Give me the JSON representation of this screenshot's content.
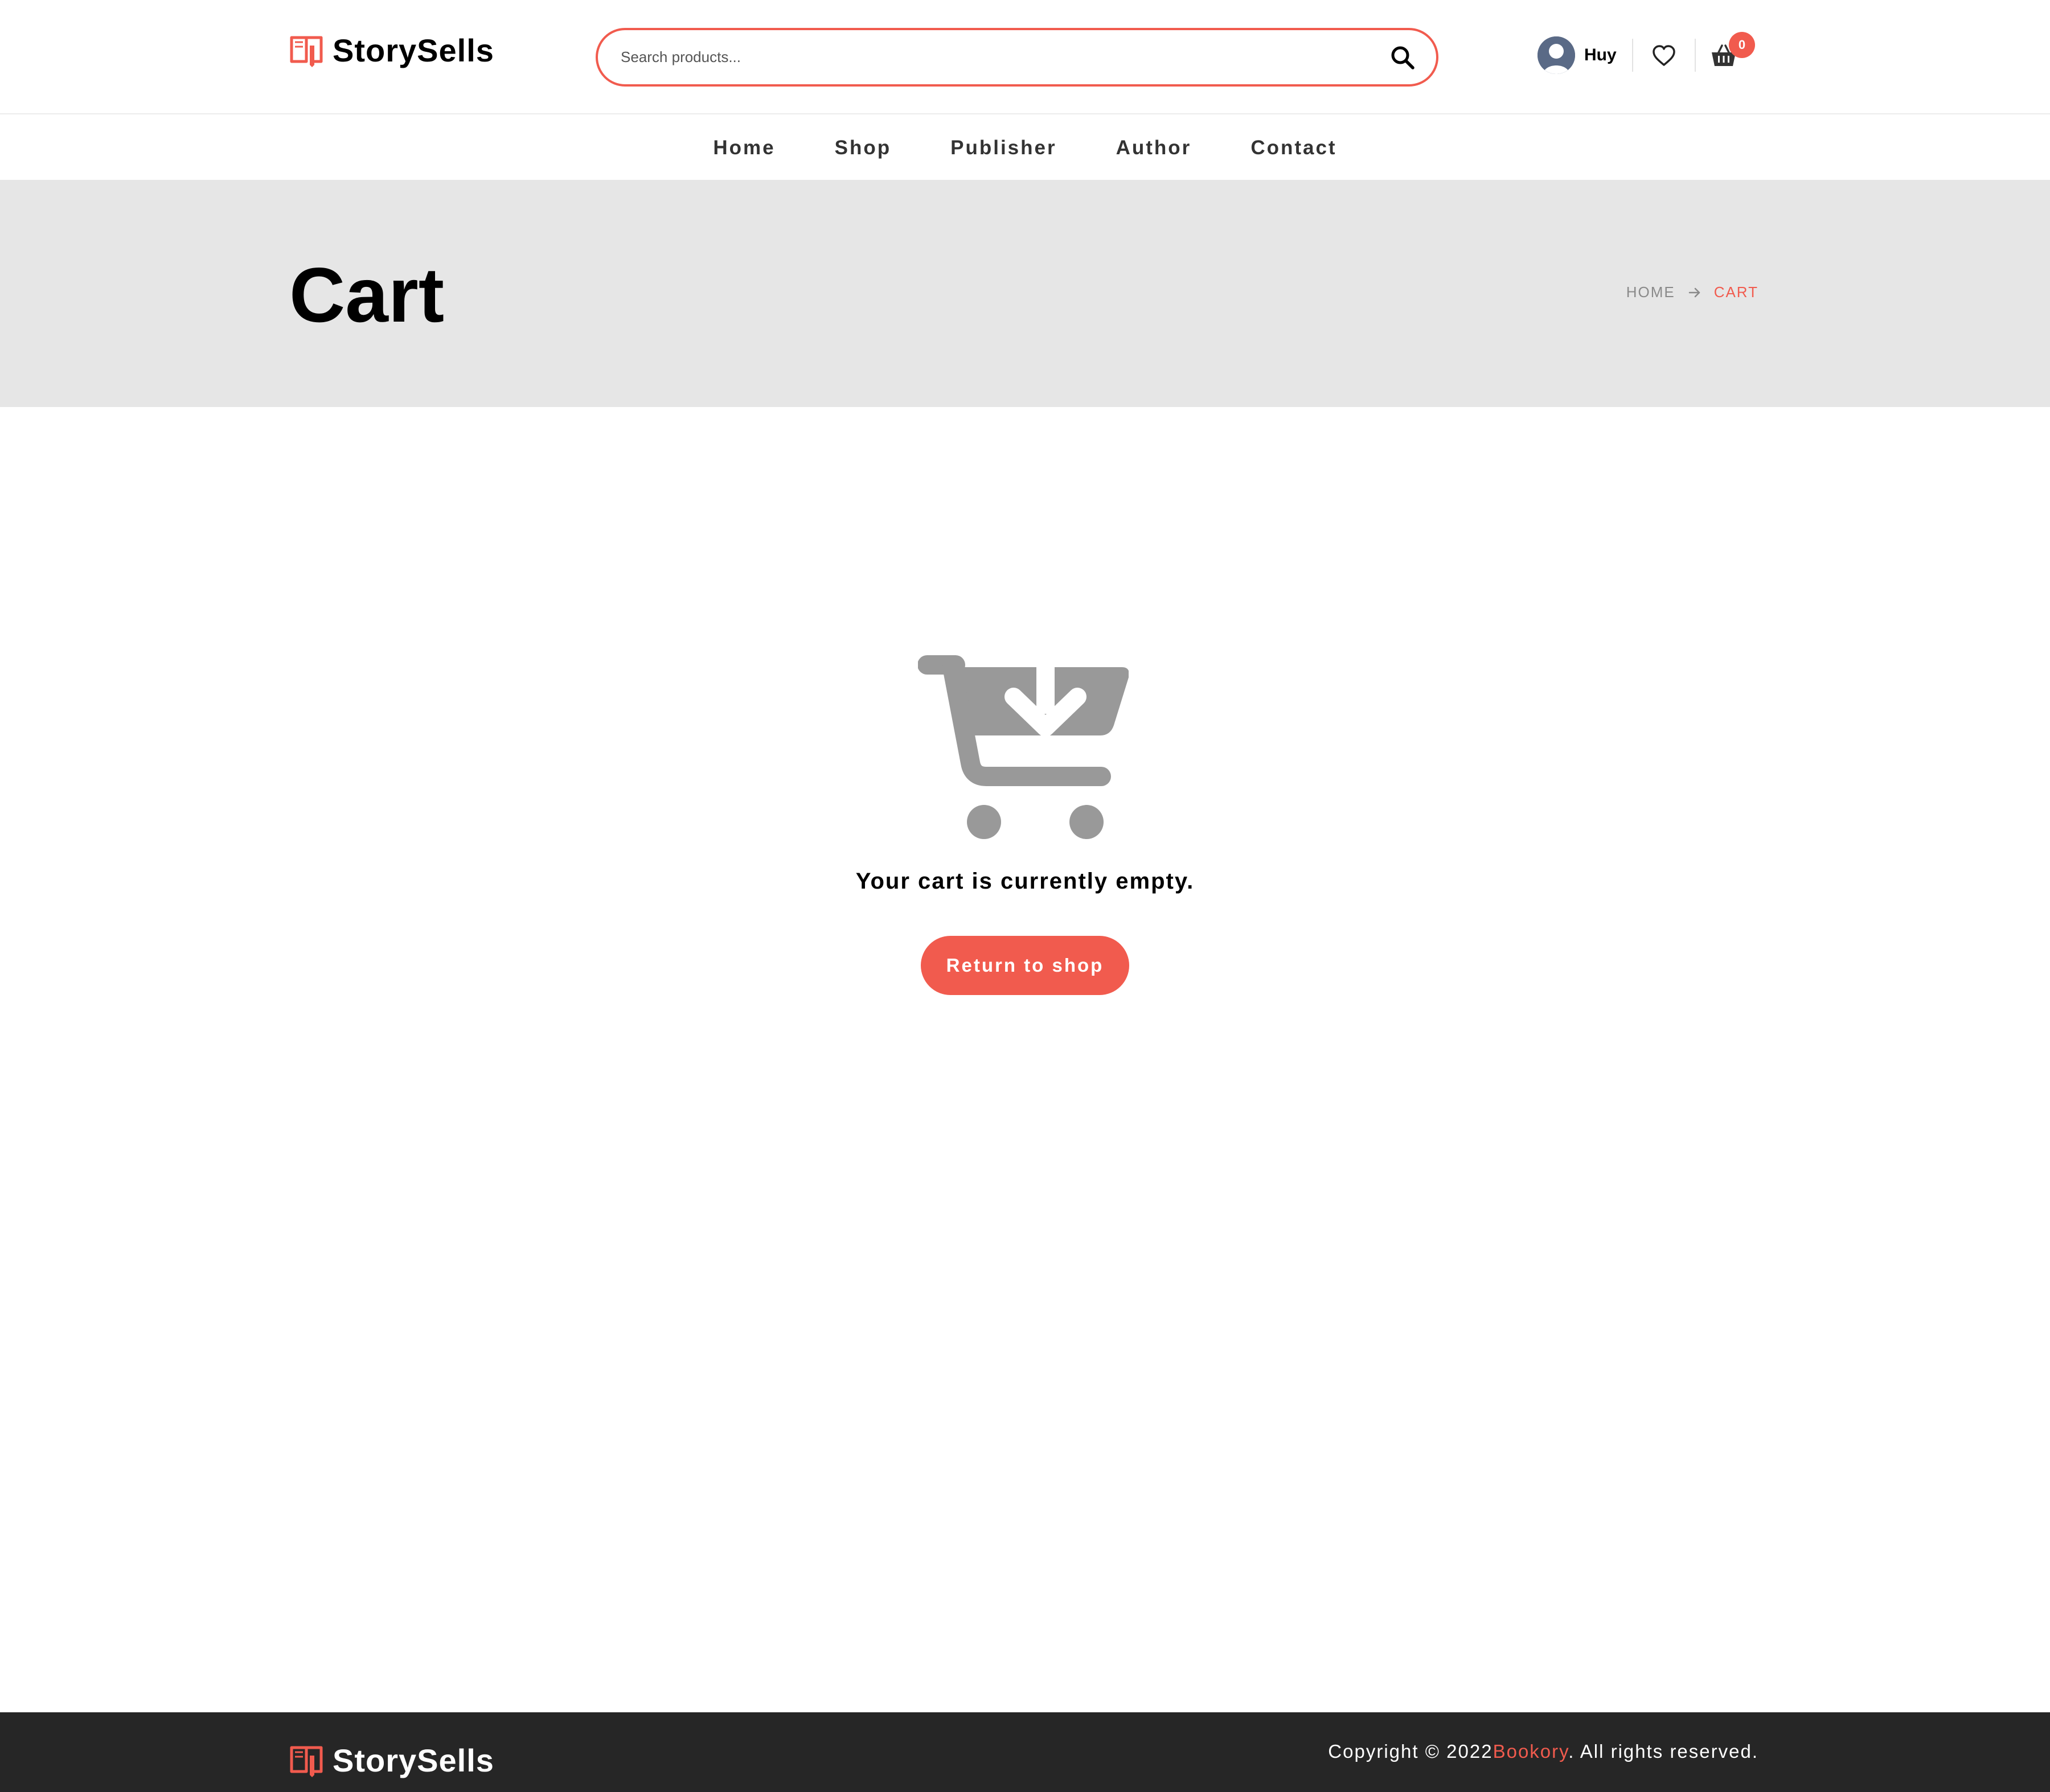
{
  "brand": {
    "name": "StorySells",
    "accent": "#f15b4e"
  },
  "header": {
    "search_placeholder": "Search products...",
    "user_name": "Huy",
    "cart_count": "0"
  },
  "nav": {
    "items": [
      "Home",
      "Shop",
      "Publisher",
      "Author",
      "Contact"
    ]
  },
  "page": {
    "title": "Cart",
    "breadcrumb": {
      "home": "HOME",
      "current": "CART"
    }
  },
  "cart": {
    "empty_message": "Your cart is currently empty.",
    "return_label": "Return to shop",
    "icon": "cart-download-icon"
  },
  "footer": {
    "copyright_prefix": "Copyright © 2022",
    "copyright_brand": "Bookory",
    "copyright_suffix": ". All rights reserved."
  }
}
